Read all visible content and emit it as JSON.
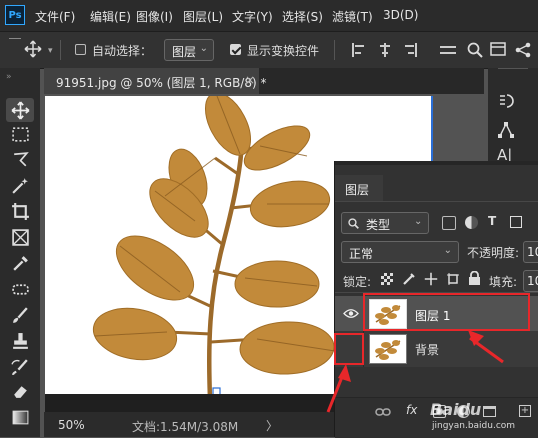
{
  "app": {
    "logo_text": "Ps"
  },
  "menu": {
    "items": [
      "文件(F)",
      "编辑(E)",
      "图像(I)",
      "图层(L)",
      "文字(Y)",
      "选择(S)",
      "滤镜(T)",
      "3D(D)"
    ]
  },
  "options": {
    "auto_select_label": "自动选择：",
    "auto_select_checked": false,
    "auto_select_target": "图层",
    "show_transform_label": "显示变换控件",
    "show_transform_checked": true
  },
  "document": {
    "tab_title": "91951.jpg @ 50% (图层 1, RGB/8) *",
    "tab_close": "×"
  },
  "status": {
    "zoom": "50%",
    "doc_info": "文档:1.54M/3.08M",
    "arrow": "〉"
  },
  "layers_panel": {
    "title": "图层",
    "filter_type": "类型",
    "blend_mode": "正常",
    "opacity_label": "不透明度:",
    "opacity_value": "10",
    "lock_label": "锁定:",
    "fill_label": "填充:",
    "fill_value": "10",
    "layers": [
      {
        "name": "图层 1",
        "visible": true,
        "selected": true
      },
      {
        "name": "背景",
        "visible": false,
        "selected": false
      }
    ],
    "fx_label": "fx"
  },
  "watermark": {
    "text": "jingyan.baidu.com",
    "brand": "Baidu"
  },
  "colors": {
    "highlight": "#e8272a",
    "leaf": "#c28a3a",
    "stem": "#9c6a2a",
    "accent": "#31a8ff"
  }
}
